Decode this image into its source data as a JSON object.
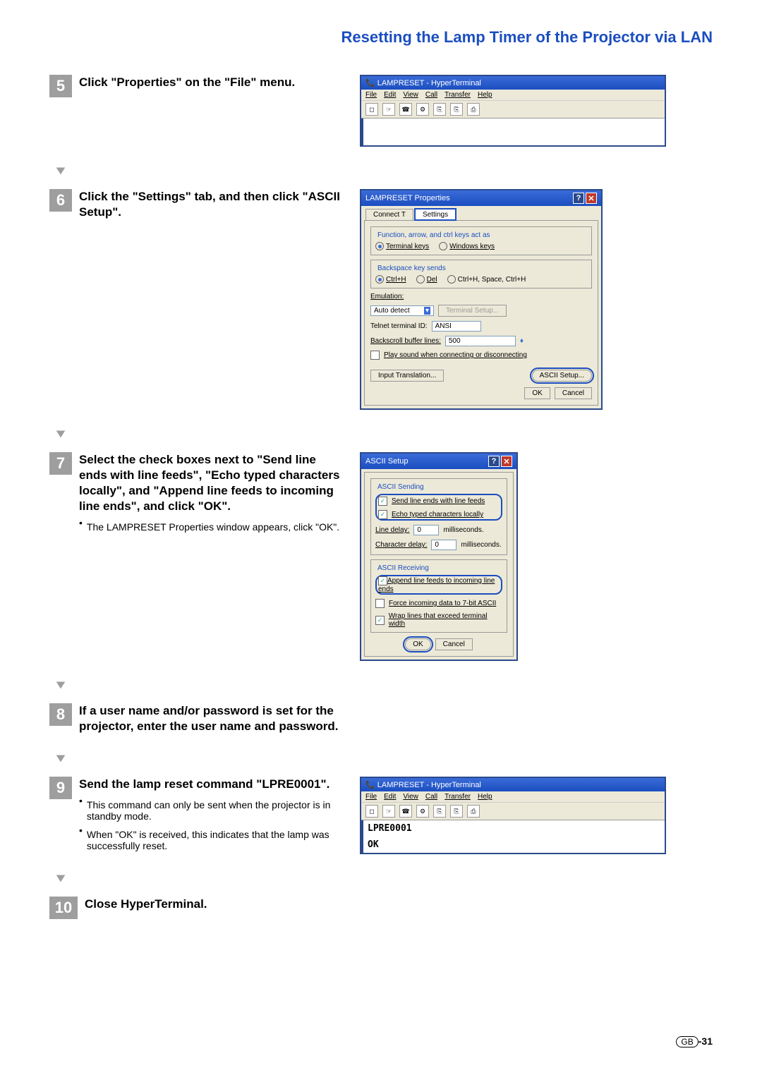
{
  "header": {
    "title": "Resetting the Lamp Timer of the Projector via LAN"
  },
  "steps": {
    "5": {
      "num": "5",
      "title": "Click \"Properties\" on the \"File\" menu."
    },
    "6": {
      "num": "6",
      "title": "Click the \"Settings\" tab, and then click \"ASCII Setup\"."
    },
    "7": {
      "num": "7",
      "title": "Select the check boxes next to \"Send line ends with line feeds\", \"Echo typed characters locally\", and \"Append line feeds to incoming line ends\", and click \"OK\".",
      "note": "The LAMPRESET Properties window appears, click \"OK\"."
    },
    "8": {
      "num": "8",
      "title": "If a user name and/or password is set for the projector, enter the user name and password."
    },
    "9": {
      "num": "9",
      "title": "Send the lamp reset command \"LPRE0001\".",
      "b1": "This command can only be sent when the projector is in standby mode.",
      "b2": "When \"OK\" is received, this indicates that the lamp was successfully reset."
    },
    "10": {
      "num": "10",
      "title": "Close HyperTerminal."
    }
  },
  "ht": {
    "appTitle": "LAMPRESET - HyperTerminal",
    "menus": {
      "file": "File",
      "edit": "Edit",
      "view": "View",
      "call": "Call",
      "transfer": "Transfer",
      "help": "Help"
    },
    "toolbar": [
      "D",
      "☞",
      "☎",
      "⚙",
      "⎘",
      "⎘",
      "⎙"
    ]
  },
  "props": {
    "title": "LAMPRESET Properties",
    "tab1": "Connect T",
    "tab2": "Settings",
    "group1": "Function, arrow, and ctrl keys act as",
    "r1a": "Terminal keys",
    "r1b": "Windows keys",
    "group2": "Backspace key sends",
    "r2a": "Ctrl+H",
    "r2b": "Del",
    "r2c": "Ctrl+H, Space, Ctrl+H",
    "emuLabel": "Emulation:",
    "emuVal": "Auto detect",
    "termSetup": "Terminal Setup...",
    "telnetLabel": "Telnet terminal ID:",
    "telnetVal": "ANSI",
    "backLabel": "Backscroll buffer lines:",
    "backVal": "500",
    "playSound": "Play sound when connecting or disconnecting",
    "inputTrans": "Input Translation...",
    "asciiSetup": "ASCII Setup...",
    "ok": "OK",
    "cancel": "Cancel"
  },
  "ascii": {
    "title": "ASCII Setup",
    "g1": "ASCII Sending",
    "c1": "Send line ends with line feeds",
    "c2": "Echo typed characters locally",
    "lineDelay": "Line delay:",
    "lineVal": "0",
    "ms": "milliseconds.",
    "charDelay": "Character delay:",
    "charVal": "0",
    "g2": "ASCII Receiving",
    "c3": "Append line feeds to incoming line ends",
    "c4": "Force incoming data to 7-bit ASCII",
    "c5": "Wrap lines that exceed terminal width",
    "ok": "OK",
    "cancel": "Cancel"
  },
  "term": {
    "cmd": "LPRE0001",
    "resp": "OK"
  },
  "footer": {
    "gb": "GB",
    "page": "-31"
  }
}
